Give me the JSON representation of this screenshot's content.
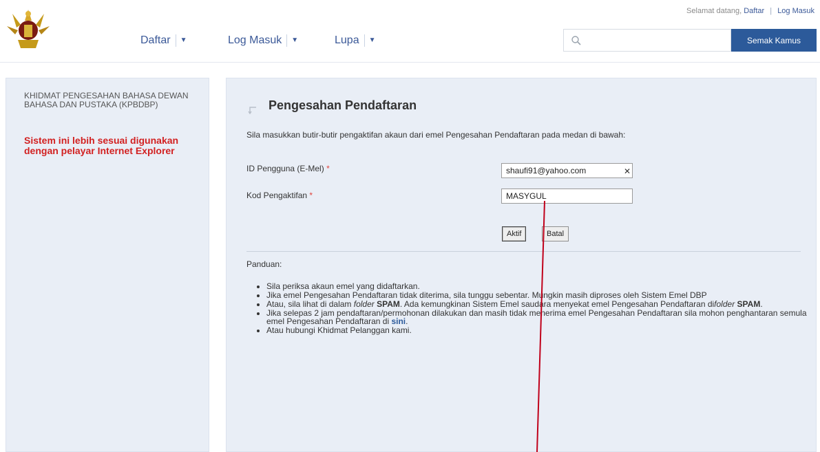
{
  "header": {
    "welcome": {
      "greeting": "Selamat datang,",
      "register": "Daftar",
      "login": "Log Masuk"
    },
    "nav": [
      {
        "label": "Daftar"
      },
      {
        "label": "Log Masuk"
      },
      {
        "label": "Lupa"
      }
    ],
    "search": {
      "placeholder": "",
      "button_label": "Semak Kamus"
    }
  },
  "sidebar": {
    "org": "KHIDMAT PENGESAHAN BAHASA DEWAN BAHASA DAN PUSTAKA (KPBDBP)",
    "note": "Sistem ini lebih sesuai digunakan dengan pelayar Internet Explorer"
  },
  "form": {
    "title": "Pengesahan Pendaftaran",
    "intro": "Sila masukkan butir-butir pengaktifan akaun dari emel Pengesahan Pendaftaran pada medan di bawah:",
    "user_id": {
      "label": "ID Pengguna (E-Mel)",
      "value": "shaufi91@yahoo.com"
    },
    "code": {
      "label": "Kod Pengaktifan",
      "value": "MASYGUL"
    },
    "required_marker": "*",
    "submit_label": "Aktif",
    "cancel_label": "Batal"
  },
  "guide": {
    "title": "Panduan:",
    "items": [
      "Sila periksa akaun emel yang didaftarkan.",
      "Jika emel Pengesahan Pendaftaran tidak diterima, sila tunggu sebentar. Mungkin masih diproses oleh Sistem Emel DBP",
      {
        "pre": "Atau, sila lihat di dalam ",
        "em": "folder",
        "b1": " SPAM",
        "mid": ". Ada kemungkinan Sistem Emel saudara menyekat emel Pengesahan Pendaftaran di",
        "em2": "folder",
        "b2": " SPAM",
        "post": "."
      },
      {
        "pre": "Jika selepas 2 jam pendaftaran/permohonan dilakukan dan masih tidak menerima emel Pengesahan Pendaftaran sila mohon penghantaran semula emel Pengesahan Pendaftaran di ",
        "link": "sini",
        "post": "."
      },
      "Atau hubungi Khidmat Pelanggan kami."
    ]
  },
  "colors": {
    "brand": "#3b5998",
    "search_button": "#2c5a9a",
    "panel": "#e9eef6",
    "warning": "#d22121",
    "annotation_line": "#c0001a"
  },
  "icons": [
    "logo-emblem",
    "search-icon",
    "chevron-down-icon",
    "title-arrow-icon",
    "clear-icon"
  ]
}
